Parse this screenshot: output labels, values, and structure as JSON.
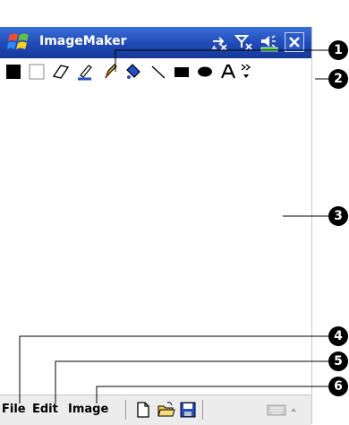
{
  "app": {
    "title": "ImageMaker"
  },
  "menubar": {
    "file": "File",
    "edit": "Edit",
    "image": "Image"
  },
  "callouts": [
    "1",
    "2",
    "3",
    "4",
    "5",
    "6"
  ],
  "colors": {
    "titlebar": "#1f49b6",
    "accent": "#2b59c8"
  }
}
